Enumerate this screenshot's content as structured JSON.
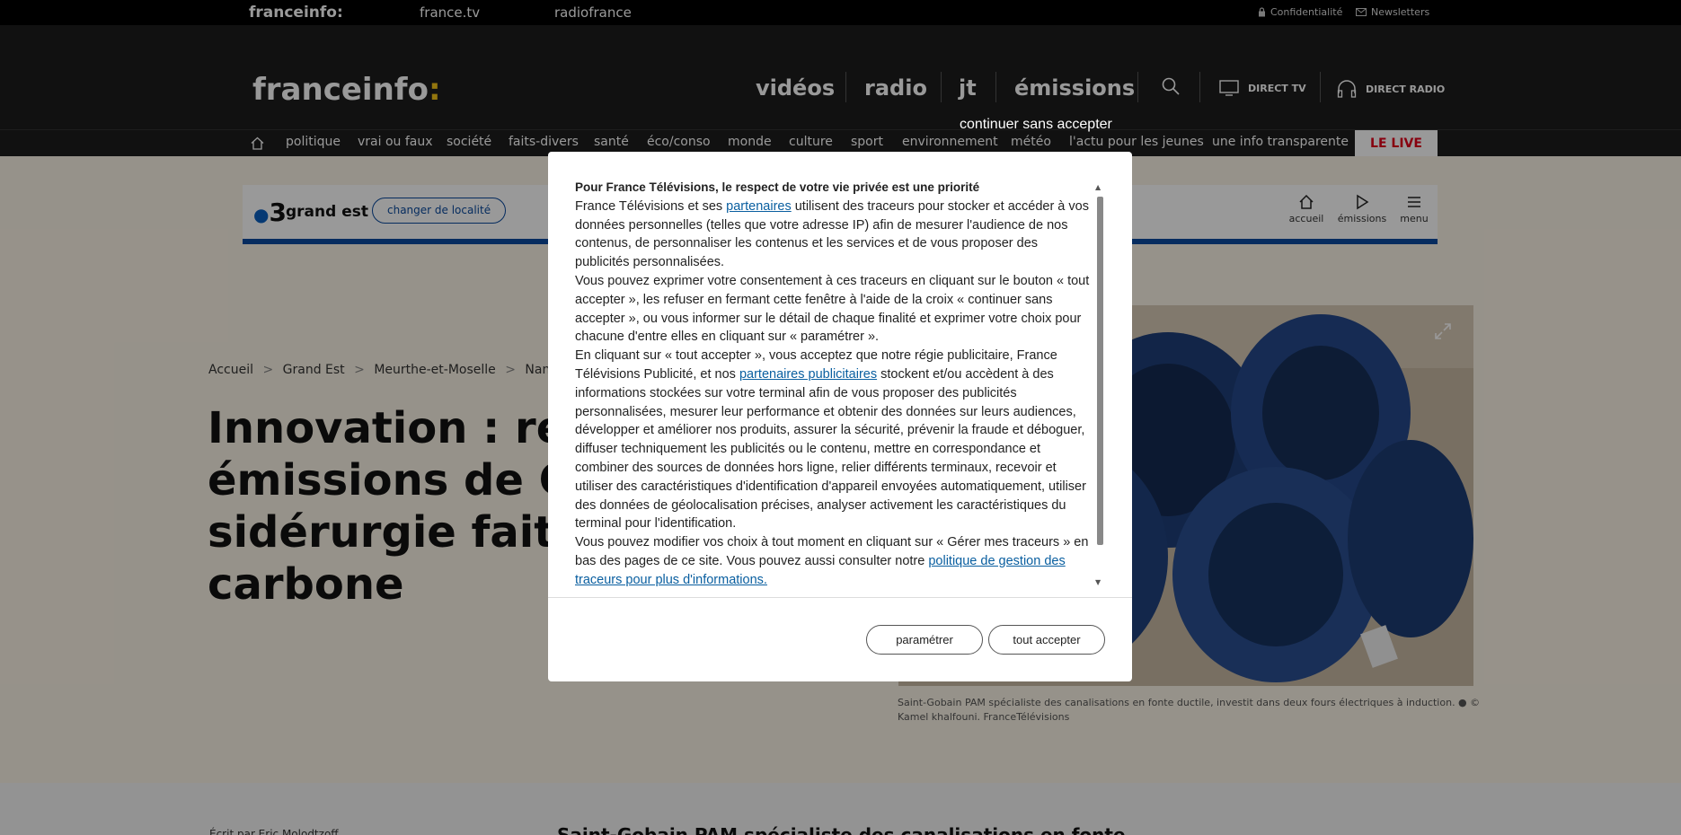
{
  "topbar": {
    "brand": "franceinfo:",
    "francetv": "france.tv",
    "radiofrance": "radiofrance",
    "privacy": "Confidentialité",
    "newsletters": "Newsletters"
  },
  "header": {
    "logo": "franceinfo",
    "logo_colon": ":",
    "nav": [
      "vidéos",
      "radio",
      "jt",
      "émissions"
    ],
    "direct_tv": "DIRECT TV",
    "direct_radio": "DIRECT RADIO"
  },
  "subnav": {
    "items": [
      "politique",
      "vrai ou faux",
      "société",
      "faits-divers",
      "santé",
      "éco/conso",
      "monde",
      "culture",
      "sport",
      "environnement",
      "météo",
      "l'actu pour les jeunes",
      "une info transparente"
    ],
    "live": "LE LIVE"
  },
  "region": {
    "name": "grand est",
    "change": "changer de localité",
    "nav": [
      "accueil",
      "émissions",
      "menu"
    ]
  },
  "breadcrumb": [
    "Accueil",
    "Grand Est",
    "Meurthe-et-Moselle",
    "Nancy"
  ],
  "article": {
    "title": "Innovation : réduire les émissions de CO2, la sidérurgie fait sa mue bas-carbone",
    "caption": "Saint-Gobain PAM spécialiste des canalisations en fonte ductile, investit dans deux fours électriques à induction. ● © Kamel khalfouni. FranceTélévisions"
  },
  "below": {
    "author": "Écrit par Eric Molodtzoff",
    "headline": "Saint-Gobain PAM spécialiste des canalisations en fonte"
  },
  "consent": {
    "continue": "continuer sans accepter",
    "title": "Pour France Télévisions, le respect de votre vie privée est une priorité",
    "p1a": "France Télévisions et ses ",
    "p1link": "partenaires",
    "p1b": " utilisent des traceurs pour stocker et accéder à vos données personnelles (telles que votre adresse IP) afin de mesurer l'audience de nos contenus, de personnaliser les contenus et les services et de vous proposer des publicités personnalisées.",
    "p2": "Vous pouvez exprimer votre consentement à ces traceurs en cliquant sur le bouton « tout accepter », les refuser en fermant cette fenêtre à l'aide de la croix « continuer sans accepter », ou vous informer sur le détail de chaque finalité et exprimer votre choix pour chacune d'entre elles en cliquant sur « paramétrer ».",
    "p3a": "En cliquant sur « tout accepter », vous acceptez que notre régie publicitaire, France Télévisions Publicité, et nos ",
    "p3link": "partenaires publicitaires",
    "p3b": " stockent et/ou accèdent à des informations stockées sur votre terminal afin de vous proposer des publicités personnalisées, mesurer leur performance et obtenir des données sur leurs audiences, développer et améliorer nos produits, assurer la sécurité, prévenir la fraude et déboguer, diffuser techniquement les publicités ou le contenu, mettre en correspondance et combiner des sources de données hors ligne, relier différents terminaux, recevoir et utiliser des caractéristiques d'identification d'appareil envoyées automatiquement, utiliser des données de géolocalisation précises, analyser activement les caractéristiques du terminal pour l'identification.",
    "p4a": "Vous pouvez modifier vos choix à tout moment en cliquant sur « Gérer mes traceurs » en bas des pages de ce site. Vous pouvez aussi consulter notre ",
    "p4link": "politique de gestion des traceurs pour plus d'informations.",
    "btn_settings": "paramétrer",
    "btn_accept": "tout accepter"
  }
}
